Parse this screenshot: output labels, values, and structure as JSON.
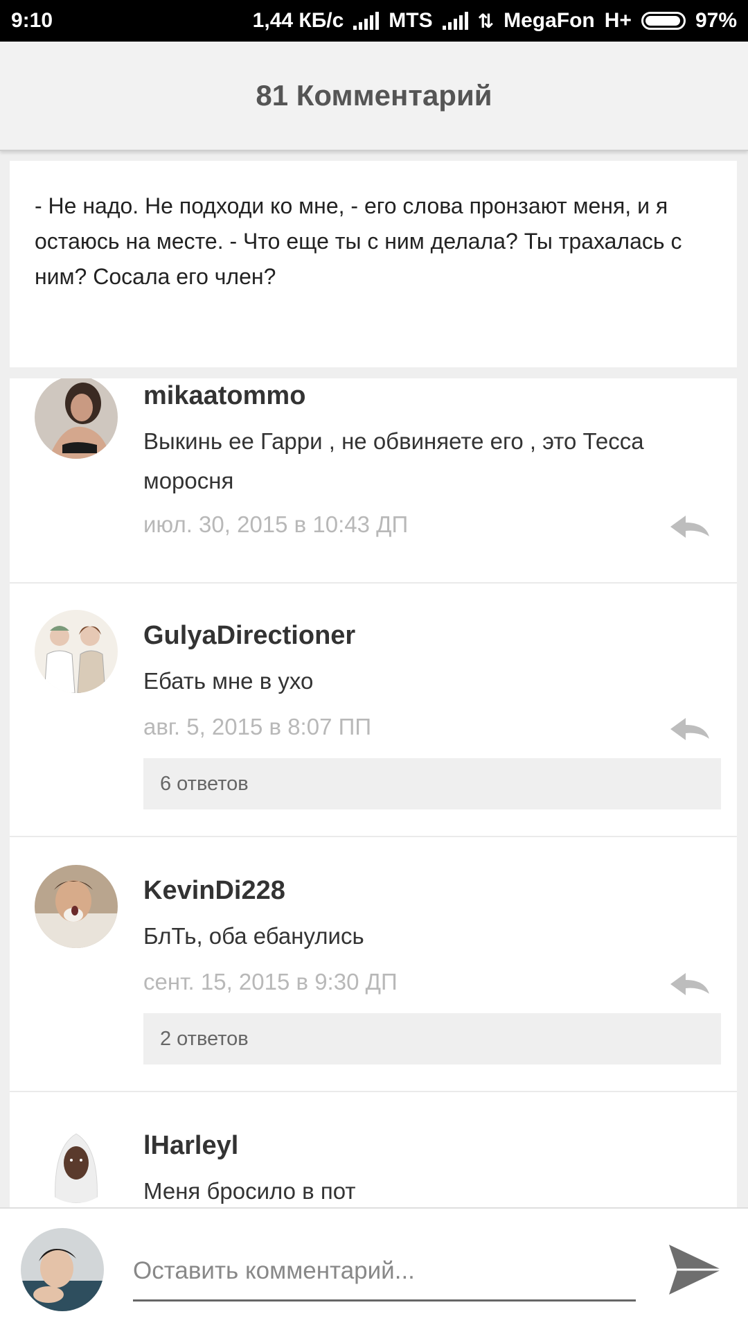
{
  "status_bar": {
    "time": "9:10",
    "speed": "1,44 КБ/с",
    "carrier1": "MTS",
    "carrier2": "MegaFon",
    "network": "H+",
    "battery": "97%",
    "battery_level": 0.97
  },
  "header": {
    "title": "81 Комментарий"
  },
  "quote": {
    "text": "- Не надо. Не подходи ко мне, - его слова пронзают меня, и я остаюсь на месте. - Что еще ты с ним делала? Ты трахалась с ним? Сосала его член?"
  },
  "comments": [
    {
      "username": "mikaatommo",
      "text": "Выкинь ее Гарри , не обвиняете его , это Тесса моросня",
      "date": "июл. 30, 2015 в 10:43 ДП",
      "replies": ""
    },
    {
      "username": "GulyaDirectioner",
      "text": "Ебать мне в ухо",
      "date": "авг. 5, 2015 в 8:07 ПП",
      "replies": "6 ответов"
    },
    {
      "username": "KevinDi228",
      "text": "БлТь, оба ебанулись",
      "date": "сент. 15, 2015 в 9:30 ДП",
      "replies": "2 ответов"
    },
    {
      "username": "lHarleyl",
      "text": "Меня бросило в пот",
      "date": "",
      "replies": ""
    }
  ],
  "input": {
    "placeholder": "Оставить комментарий..."
  },
  "icons": {
    "reply": "reply-arrow-icon",
    "send": "send-icon"
  },
  "colors": {
    "statusbar": "#000000",
    "header_bg": "#f2f2f2",
    "date_text": "#b8b8b8",
    "replies_bg": "#efefef"
  }
}
